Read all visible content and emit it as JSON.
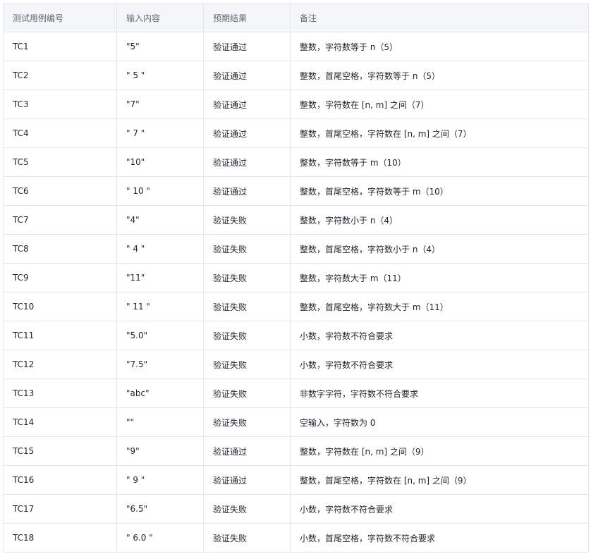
{
  "table": {
    "headers": [
      "测试用例编号",
      "输入内容",
      "预期结果",
      "备注"
    ],
    "rows": [
      [
        "TC1",
        "\"5\"",
        "验证通过",
        "整数，字符数等于 n（5）"
      ],
      [
        "TC2",
        "\" 5 \"",
        "验证通过",
        "整数，首尾空格，字符数等于 n（5）"
      ],
      [
        "TC3",
        "\"7\"",
        "验证通过",
        "整数，字符数在 [n, m] 之间（7）"
      ],
      [
        "TC4",
        "\" 7 \"",
        "验证通过",
        "整数，首尾空格，字符数在 [n, m] 之间（7）"
      ],
      [
        "TC5",
        "\"10\"",
        "验证通过",
        "整数，字符数等于 m（10）"
      ],
      [
        "TC6",
        "\" 10 \"",
        "验证通过",
        "整数，首尾空格，字符数等于 m（10）"
      ],
      [
        "TC7",
        "\"4\"",
        "验证失败",
        "整数，字符数小于 n（4）"
      ],
      [
        "TC8",
        "\" 4 \"",
        "验证失败",
        "整数，首尾空格，字符数小于 n（4）"
      ],
      [
        "TC9",
        "\"11\"",
        "验证失败",
        "整数，字符数大于 m（11）"
      ],
      [
        "TC10",
        "\" 11 \"",
        "验证失败",
        "整数，首尾空格，字符数大于 m（11）"
      ],
      [
        "TC11",
        "\"5.0\"",
        "验证失败",
        "小数，字符数不符合要求"
      ],
      [
        "TC12",
        "\"7.5\"",
        "验证失败",
        "小数，字符数不符合要求"
      ],
      [
        "TC13",
        "\"abc\"",
        "验证失败",
        "非数字字符，字符数不符合要求"
      ],
      [
        "TC14",
        "\"\"",
        "验证失败",
        "空输入，字符数为 0"
      ],
      [
        "TC15",
        "\"9\"",
        "验证通过",
        "整数，字符数在 [n, m] 之间（9）"
      ],
      [
        "TC16",
        "\" 9 \"",
        "验证通过",
        "整数，首尾空格，字符数在 [n, m] 之间（9）"
      ],
      [
        "TC17",
        "\"6.5\"",
        "验证失败",
        "小数，字符数不符合要求"
      ],
      [
        "TC18",
        "\" 6.0 \"",
        "验证失败",
        "小数，首尾空格，字符数不符合要求"
      ]
    ]
  }
}
